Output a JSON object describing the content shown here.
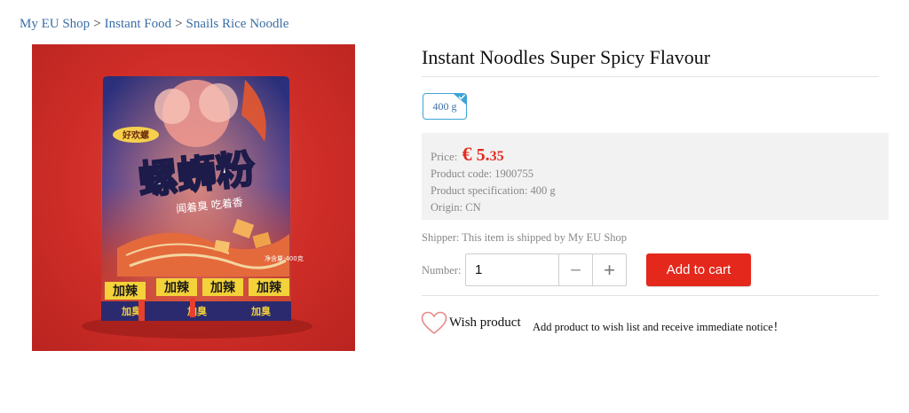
{
  "breadcrumb": {
    "items": [
      "My EU Shop",
      "Instant Food",
      "Snails Rice Noodle"
    ],
    "separator": ">"
  },
  "product": {
    "title": "Instant Noodles Super Spicy Flavour",
    "variant": "400 g",
    "price_label": "Price:",
    "price_currency": "€",
    "price_main": "5.",
    "price_cents": "35",
    "code": "Product code: 1900755",
    "spec": "Product specification: 400 g",
    "origin": "Origin: CN",
    "shipper": "Shipper: This item is shipped by My EU Shop",
    "image_text": {
      "brand": "好欢螺",
      "title": "螺蛳粉",
      "subtitle": "闻着臭 吃着香",
      "badges": [
        "加辣",
        "加辣",
        "加辣",
        "加辣"
      ],
      "bottom": [
        "加臭",
        "加臭",
        "加臭"
      ],
      "net": "净含量:400克"
    }
  },
  "purchase": {
    "number_label": "Number:",
    "quantity": "1",
    "minus": "−",
    "plus": "+",
    "add_to_cart": "Add to cart"
  },
  "wishlist": {
    "label": "Wish product",
    "note": "Add product to wish list and receive immediate notice！"
  },
  "colors": {
    "link": "#3a6ea5",
    "price": "#e32b1e",
    "cart_button": "#e4281c",
    "variant_border": "#3fa3d6"
  }
}
